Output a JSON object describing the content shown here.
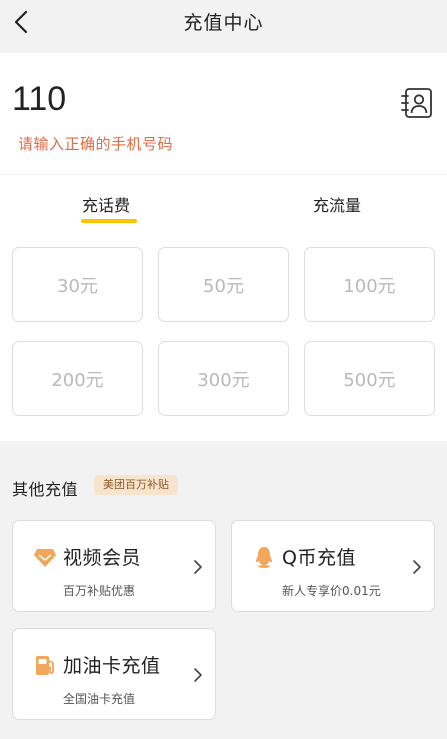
{
  "nav": {
    "title": "充值中心"
  },
  "phone": {
    "number": "110",
    "error": "请输入正确的手机号码"
  },
  "tabs": [
    {
      "label": "充话费",
      "active": true
    },
    {
      "label": "充流量",
      "active": false
    }
  ],
  "amounts": [
    "30元",
    "50元",
    "100元",
    "200元",
    "300元",
    "500元"
  ],
  "other": {
    "title": "其他充值",
    "badge": "美团百万补贴",
    "items": [
      {
        "name": "视频会员",
        "sub": "百万补贴优惠",
        "icon": "diamond-icon"
      },
      {
        "name": "Q币充值",
        "sub": "新人专享价0.01元",
        "icon": "qq-penguin-icon"
      },
      {
        "name": "加油卡充值",
        "sub": "全国油卡充值",
        "icon": "fuel-pump-icon"
      }
    ]
  },
  "colors": {
    "accent": "#ffc300",
    "error": "#e26b47",
    "icon": "#f2a65a",
    "badge_bg": "#f8e3cd"
  }
}
